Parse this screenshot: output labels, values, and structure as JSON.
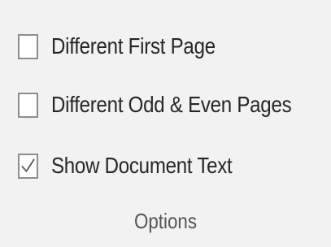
{
  "options": [
    {
      "label": "Different First Page",
      "checked": false
    },
    {
      "label": "Different Odd & Even Pages",
      "checked": false
    },
    {
      "label": "Show Document Text",
      "checked": true
    }
  ],
  "group": {
    "label": "Options"
  },
  "colors": {
    "background": "#f2f2f2",
    "checkbox_border": "#8d8d8d",
    "checkmark": "#5a5a5a",
    "text": "#262626",
    "group_label": "#555555"
  },
  "icons": {
    "checkmark": "checkmark-icon"
  }
}
